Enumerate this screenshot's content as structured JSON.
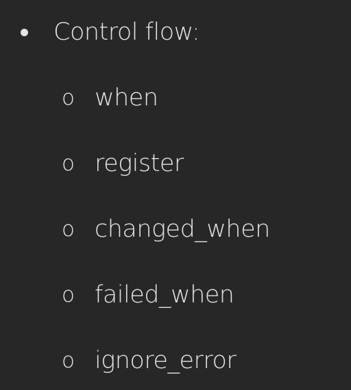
{
  "bullet": {
    "heading": "Control flow:",
    "markers": {
      "level1": "•",
      "level2": "o"
    },
    "items": [
      {
        "label": "when"
      },
      {
        "label": "register"
      },
      {
        "label": "changed_when"
      },
      {
        "label": "failed_when"
      },
      {
        "label": "ignore_error"
      }
    ]
  },
  "colors": {
    "background": "#272727",
    "text": "#e4e4e4"
  }
}
